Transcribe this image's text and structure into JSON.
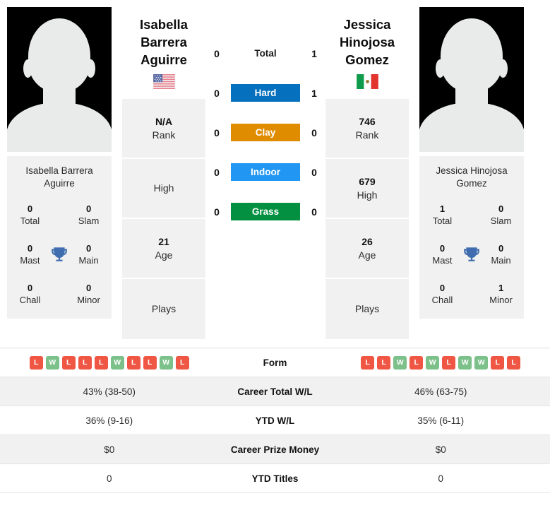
{
  "players": {
    "left": {
      "display_name_lines": [
        "Isabella",
        "Barrera Aguirre"
      ],
      "card_name": "Isabella Barrera Aguirre",
      "country_flag": "us-flag-icon",
      "country_name": "United States",
      "titles": {
        "total_value": "0",
        "total_label": "Total",
        "slam_value": "0",
        "slam_label": "Slam",
        "mast_value": "0",
        "mast_label": "Mast",
        "main_value": "0",
        "main_label": "Main",
        "chall_value": "0",
        "chall_label": "Chall",
        "minor_value": "0",
        "minor_label": "Minor"
      },
      "info": {
        "rank_value": "N/A",
        "rank_label": "Rank",
        "high_value": "",
        "high_label": "High",
        "age_value": "21",
        "age_label": "Age",
        "plays_value": "",
        "plays_label": "Plays"
      },
      "form": [
        "L",
        "W",
        "L",
        "L",
        "L",
        "W",
        "L",
        "L",
        "W",
        "L"
      ],
      "career_total_wl": "43% (38-50)",
      "ytd_wl": "36% (9-16)",
      "career_prize_money": "$0",
      "ytd_titles": "0"
    },
    "right": {
      "display_name_lines": [
        "Jessica",
        "Hinojosa",
        "Gomez"
      ],
      "card_name": "Jessica Hinojosa Gomez",
      "country_flag": "mx-flag-icon",
      "country_name": "Mexico",
      "titles": {
        "total_value": "1",
        "total_label": "Total",
        "slam_value": "0",
        "slam_label": "Slam",
        "mast_value": "0",
        "mast_label": "Mast",
        "main_value": "0",
        "main_label": "Main",
        "chall_value": "0",
        "chall_label": "Chall",
        "minor_value": "1",
        "minor_label": "Minor"
      },
      "info": {
        "rank_value": "746",
        "rank_label": "Rank",
        "high_value": "679",
        "high_label": "High",
        "age_value": "26",
        "age_label": "Age",
        "plays_value": "",
        "plays_label": "Plays"
      },
      "form": [
        "L",
        "L",
        "W",
        "L",
        "W",
        "L",
        "W",
        "W",
        "L",
        "L"
      ],
      "career_total_wl": "46% (63-75)",
      "ytd_wl": "35% (6-11)",
      "career_prize_money": "$0",
      "ytd_titles": "0"
    }
  },
  "surfaces": [
    {
      "label": "Total",
      "left": "0",
      "right": "1",
      "color": "",
      "plain": true
    },
    {
      "label": "Hard",
      "left": "0",
      "right": "1",
      "color": "#0570bd",
      "plain": false
    },
    {
      "label": "Clay",
      "left": "0",
      "right": "0",
      "color": "#e08c00",
      "plain": false
    },
    {
      "label": "Indoor",
      "left": "0",
      "right": "0",
      "color": "#2196f3",
      "plain": false
    },
    {
      "label": "Grass",
      "left": "0",
      "right": "0",
      "color": "#039141",
      "plain": false
    }
  ],
  "table_rows": [
    {
      "label": "Form",
      "type": "form"
    },
    {
      "label": "Career Total W/L",
      "type": "text",
      "left": "43% (38-50)",
      "right": "46% (63-75)"
    },
    {
      "label": "YTD W/L",
      "type": "text",
      "left": "36% (9-16)",
      "right": "35% (6-11)"
    },
    {
      "label": "Career Prize Money",
      "type": "text",
      "left": "$0",
      "right": "$0"
    },
    {
      "label": "YTD Titles",
      "type": "text",
      "left": "0",
      "right": "0"
    }
  ],
  "colors": {
    "hard": "#0570bd",
    "clay": "#e08c00",
    "indoor": "#2196f3",
    "grass": "#039141",
    "win_badge": "#7cc08a",
    "loss_badge": "#ef5644",
    "card_bg": "#f1f1f1",
    "trophy": "#3f6daf"
  }
}
